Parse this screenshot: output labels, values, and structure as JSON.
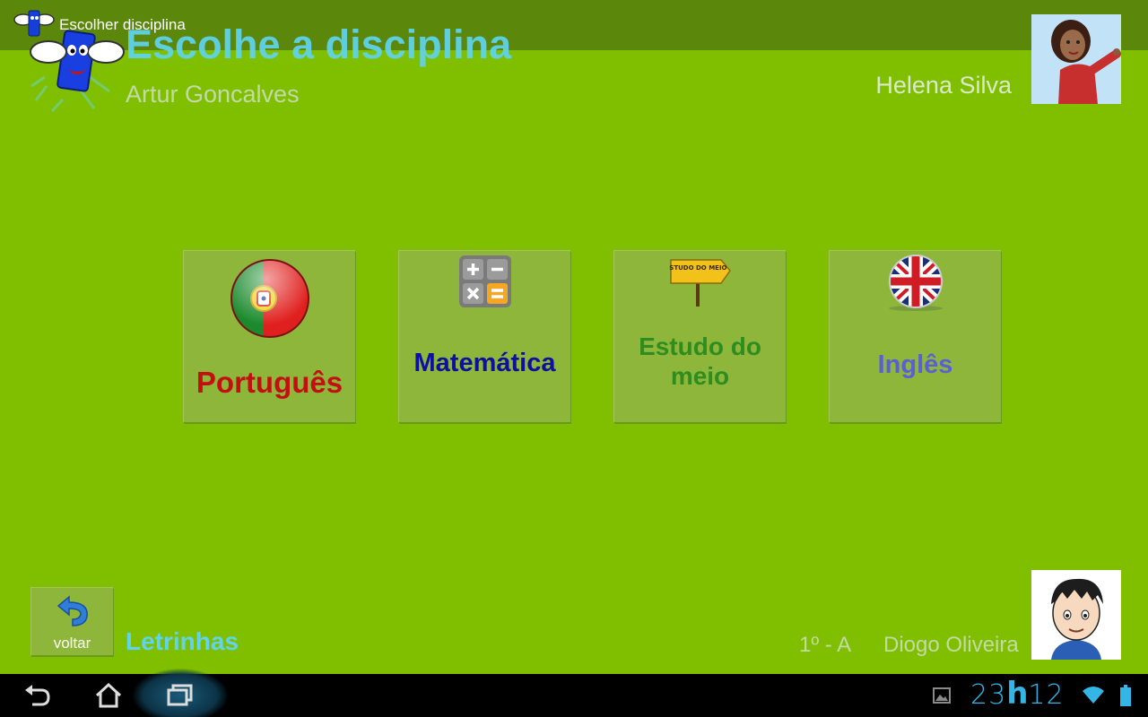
{
  "window": {
    "title": "Escolher disciplina"
  },
  "header": {
    "heading": "Escolhe a disciplina",
    "student_name": "Artur Goncalves",
    "teacher_name": "Helena Silva"
  },
  "subjects": [
    {
      "label": "Português",
      "icon": "portugal-flag-icon",
      "color": "#c30f12"
    },
    {
      "label": "Matemática",
      "icon": "calculator-icon",
      "color": "#0d0f9f"
    },
    {
      "label": "Estudo do meio",
      "icon": "signpost-icon",
      "icon_text": "ESTUDO DO MEIO",
      "color": "#2f8d20"
    },
    {
      "label": "Inglês",
      "icon": "uk-flag-icon",
      "color": "#5a5fd6"
    }
  ],
  "footer": {
    "back_label": "voltar",
    "app_name": "Letrinhas",
    "class_label": "1º - A",
    "parent_name": "Diogo Oliveira"
  },
  "status_bar": {
    "clock_hours": "23",
    "clock_separator": "h",
    "clock_minutes": "12"
  },
  "colors": {
    "background": "#80bf00",
    "tile": "#8db63a",
    "accent": "#5fd3ef",
    "clock": "#33b5e5"
  }
}
